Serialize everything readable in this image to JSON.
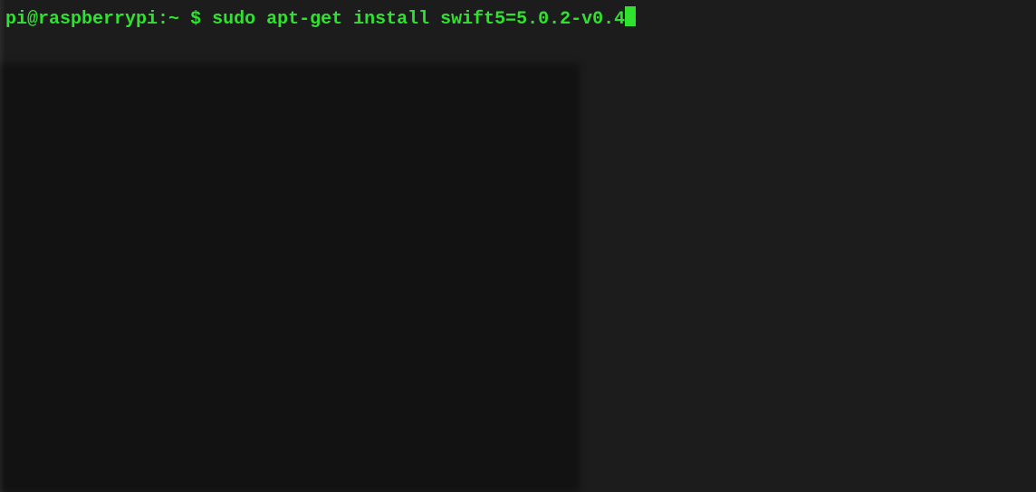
{
  "prompt": {
    "user_host": "pi@raspberrypi",
    "separator": ":",
    "cwd": "~",
    "symbol": " $ "
  },
  "command": "sudo apt-get install swift5=5.0.2-v0.4"
}
